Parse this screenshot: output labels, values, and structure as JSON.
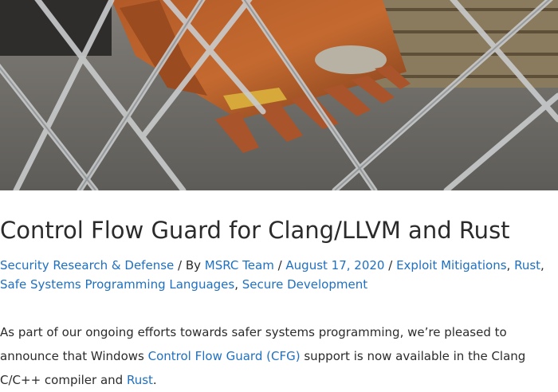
{
  "hero": {
    "image": "rusty-excavator-bucket-behind-chain-link-fence"
  },
  "article": {
    "title": "Control Flow Guard for Clang/LLVM and Rust",
    "categories": [
      "Security Research & Defense"
    ],
    "by_prefix": " / By ",
    "author": "MSRC Team",
    "date": "August 17, 2020",
    "tags": [
      "Exploit Mitigations",
      "Rust",
      "Safe Systems Programming Languages",
      "Secure Development"
    ],
    "sep_slash": " / ",
    "sep_comma": ", ",
    "body": {
      "intro": "As part of our ongoing efforts towards safer systems programming, we’re pleased to announce that Windows ",
      "link_cfg": "Control Flow Guard (CFG)",
      "middle": " support is now available in the Clang C/C++ compiler and ",
      "link_rust": "Rust",
      "end": "."
    }
  },
  "colors": {
    "link": "#1f70c1",
    "text": "#2b2b2b"
  }
}
